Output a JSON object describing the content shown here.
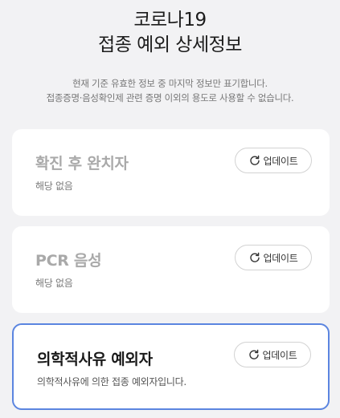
{
  "header": {
    "title_line1": "코로나19",
    "title_line2": "접종 예외 상세정보"
  },
  "notice": {
    "line1": "현재 기준 유효한 정보 중 마지막 정보만 표기합니다.",
    "line2": "접종증명·음성확인제 관련 증명 이외의 용도로 사용할 수 없습니다."
  },
  "cards": [
    {
      "title": "확진 후 완치자",
      "subtitle": "해당 없음",
      "button_label": "업데이트",
      "button_icon": "refresh-icon",
      "selected": false
    },
    {
      "title": "PCR 음성",
      "subtitle": "해당 없음",
      "button_label": "업데이트",
      "button_icon": "refresh-icon",
      "selected": false
    },
    {
      "title": "의학적사유 예외자",
      "subtitle": "의학적사유에 의한 접종 예외자입니다.",
      "button_label": "업데이트",
      "button_icon": "refresh-icon",
      "selected": true
    }
  ],
  "colors": {
    "background": "#f2f2f4",
    "selected_border": "#5b85e0",
    "inactive_title": "#a9a9a9"
  }
}
